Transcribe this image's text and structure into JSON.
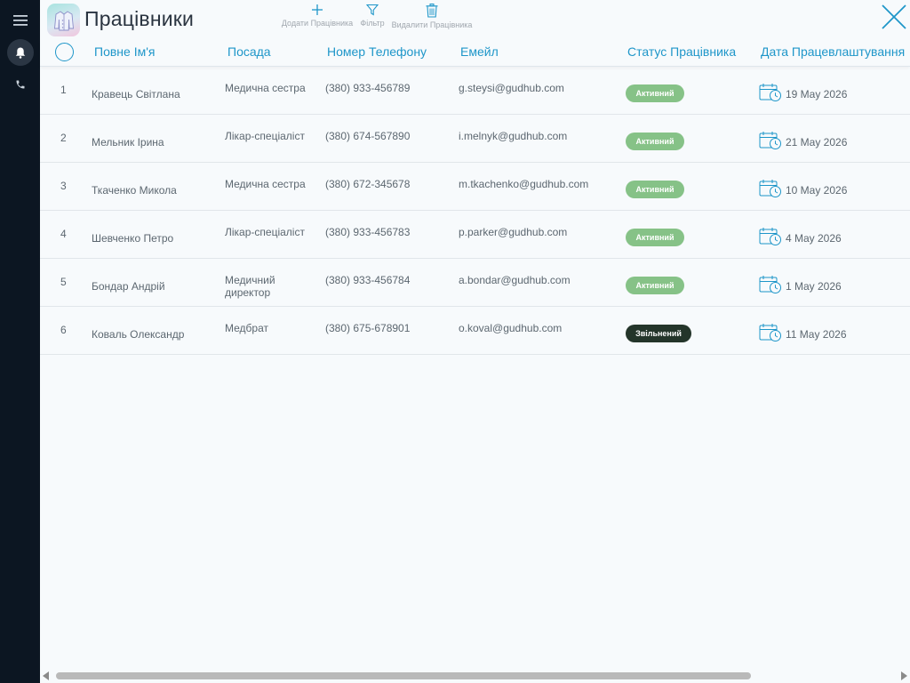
{
  "header": {
    "title": "Працівники",
    "toolbar": {
      "add_label": "Додати Працівника",
      "filter_label": "Фільтр",
      "delete_label": "Видалити Працівника"
    }
  },
  "icons": {
    "menu": "hamburger-icon",
    "notifications": "bell-icon",
    "calls": "phone-icon",
    "app": "doctor-coat-icon",
    "add": "plus-icon",
    "filter": "funnel-icon",
    "delete": "trash-icon",
    "close": "close-icon",
    "date": "calendar-clock-icon"
  },
  "colors": {
    "accent": "#1e96c9",
    "rail": "#0c1622",
    "active": "#86c287",
    "fired": "#24352a"
  },
  "table": {
    "columns": [
      "Повне Ім'я",
      "Посада",
      "Номер Телефону",
      "Емейл",
      "Статус Працівника",
      "Дата Працевлаштування"
    ],
    "rows": [
      {
        "num": "1",
        "name": "Кравець Світлана",
        "position": "Медична сестра",
        "phone": "(380) 933-456789",
        "email": "g.steysi@gudhub.com",
        "status": "Активний",
        "date": "19 May 2026"
      },
      {
        "num": "2",
        "name": "Мельник Ірина",
        "position": "Лікар-спеціаліст",
        "phone": "(380) 674-567890",
        "email": "i.melnyk@gudhub.com",
        "status": "Активний",
        "date": "21 May 2026"
      },
      {
        "num": "3",
        "name": "Ткаченко Микола",
        "position": "Медична сестра",
        "phone": "(380) 672-345678",
        "email": "m.tkachenko@gudhub.com",
        "status": "Активний",
        "date": "10 May 2026"
      },
      {
        "num": "4",
        "name": "Шевченко Петро",
        "position": "Лікар-спеціаліст",
        "phone": "(380) 933-456783",
        "email": "p.parker@gudhub.com",
        "status": "Активний",
        "date": "4 May 2026"
      },
      {
        "num": "5",
        "name": "Бондар Андрій",
        "position": "Медичний директор",
        "phone": "(380) 933-456784",
        "email": "a.bondar@gudhub.com",
        "status": "Активний",
        "date": "1 May 2026"
      },
      {
        "num": "6",
        "name": "Коваль Олександр",
        "position": "Медбрат",
        "phone": "(380) 675-678901",
        "email": "o.koval@gudhub.com",
        "status": "Звільнений",
        "date": "11 May 2026"
      }
    ]
  }
}
